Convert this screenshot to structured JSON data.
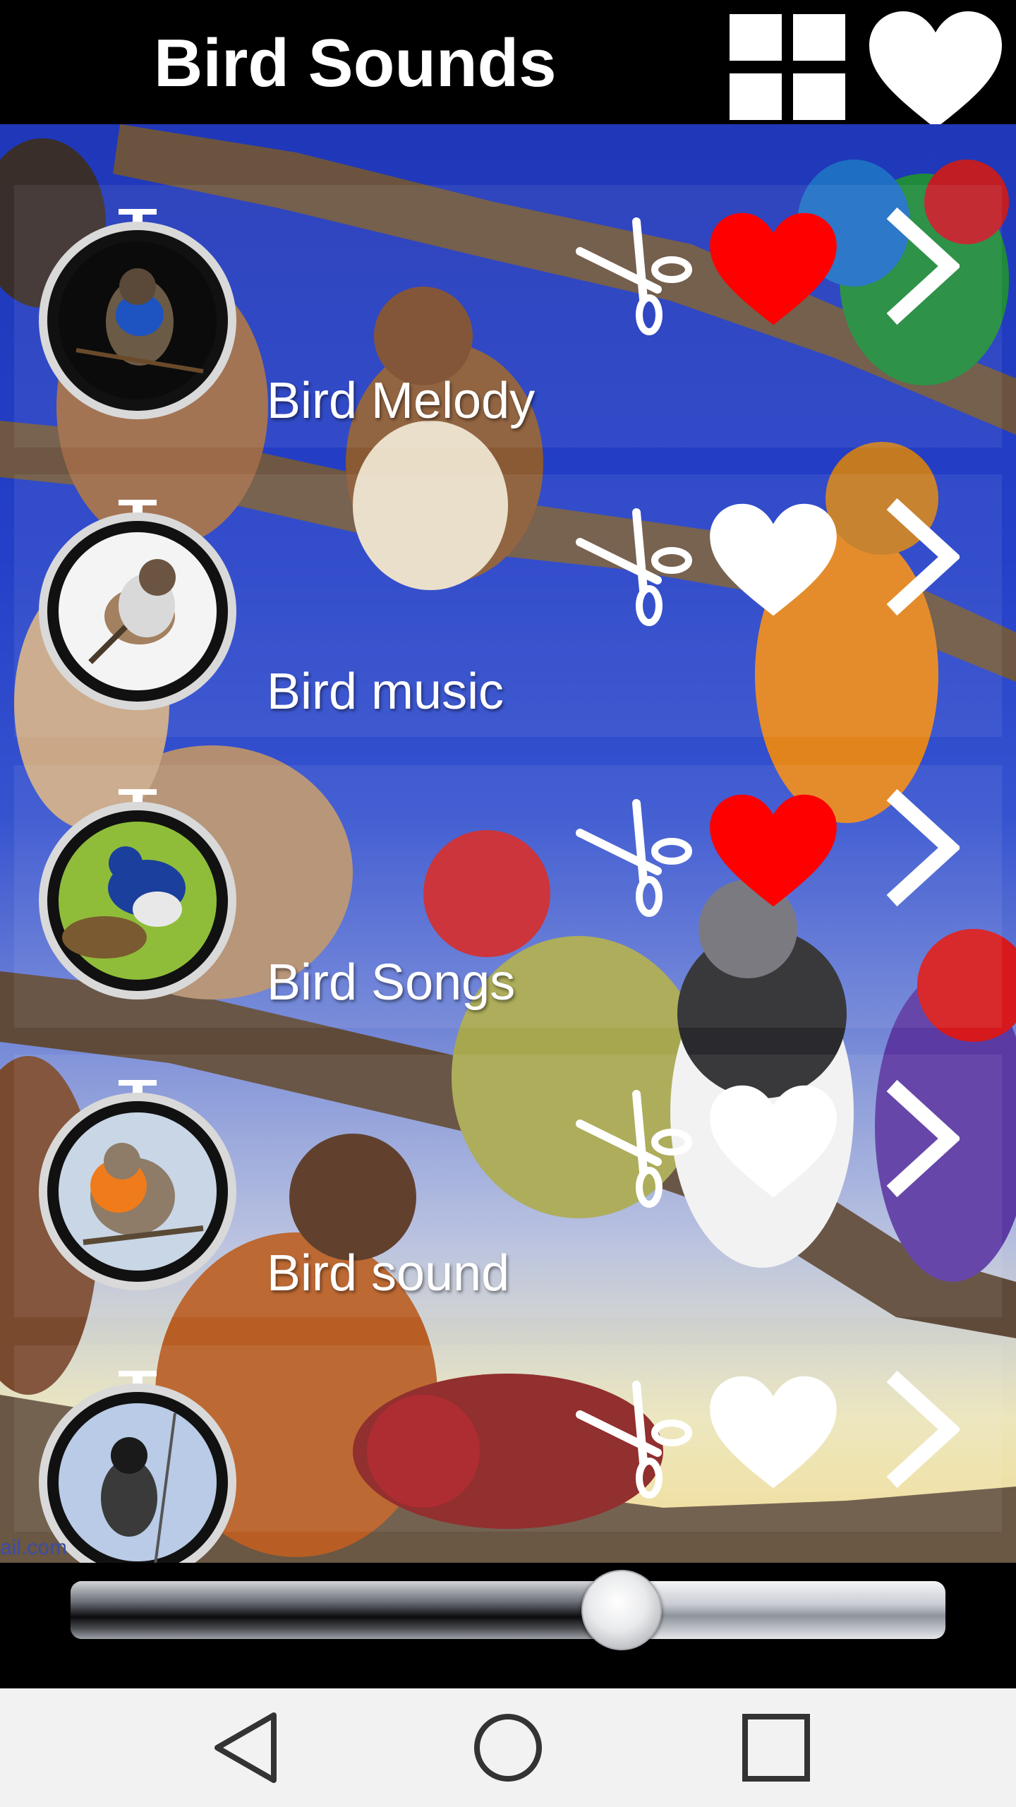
{
  "app_bar": {
    "title": "Bird Sounds",
    "grid_icon": "grid-icon",
    "favorites_icon": "heart-icon"
  },
  "sounds": [
    {
      "label": "Bird Melody",
      "thumb": "bluethroat",
      "favorite": true
    },
    {
      "label": "Bird music",
      "thumb": "sparrow",
      "favorite": false
    },
    {
      "label": "Bird Songs",
      "thumb": "blue-flycatcher",
      "favorite": true
    },
    {
      "label": "Bird sound",
      "thumb": "robin",
      "favorite": false
    },
    {
      "label": "",
      "thumb": "bulbul",
      "favorite": false
    }
  ],
  "row_icons": {
    "cut": "scissors-icon",
    "favorite": "heart-icon",
    "open": "chevron-right-icon"
  },
  "watermark": "ail.com",
  "player": {
    "progress": 0.63
  },
  "navigation": {
    "back_icon": "back-triangle-icon",
    "home_icon": "home-circle-icon",
    "recents_icon": "recents-square-icon"
  },
  "colors": {
    "favorite_on": "#ff0000",
    "favorite_off": "#ffffff",
    "top_bar": "#000000",
    "nav_bar": "#f2f2f2"
  }
}
